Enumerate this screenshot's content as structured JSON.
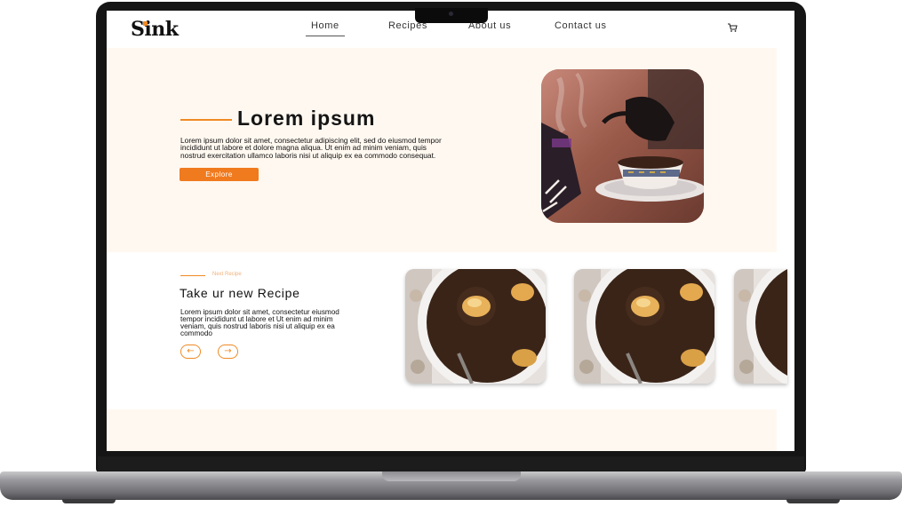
{
  "nav": {
    "logo": "Sink",
    "links": [
      {
        "label": "Home",
        "active": true
      },
      {
        "label": "Recipes"
      },
      {
        "label": "About us"
      },
      {
        "label": "Contact us"
      }
    ],
    "cart_icon": "cart-icon"
  },
  "hero": {
    "title": "Lorem ipsum",
    "text": "Lorem ipsum dolor sit amet, consectetur adipiscing elit, sed do eiusmod tempor incididunt ut labore et dolore magna aliqua. Ut enim ad minim veniam, quis nostrud exercitation ullamco laboris nisi ut aliquip ex ea commodo consequat.",
    "button_label": "Explore"
  },
  "recipes": {
    "small_label": "Next Recipe",
    "title": "Take ur new Recipe",
    "text": "Lorem ipsum dolor sit amet, consectetur eiusmod tempor incididunt ut labore et Ut enim ad minim veniam, quis nostrud laboris nisi ut aliquip ex ea commodo",
    "prev_icon": "arrow-left-icon",
    "next_icon": "arrow-right-icon"
  },
  "colors": {
    "accent": "#f07a1e",
    "hero_bg": "#fff8f0",
    "text": "#111111"
  }
}
